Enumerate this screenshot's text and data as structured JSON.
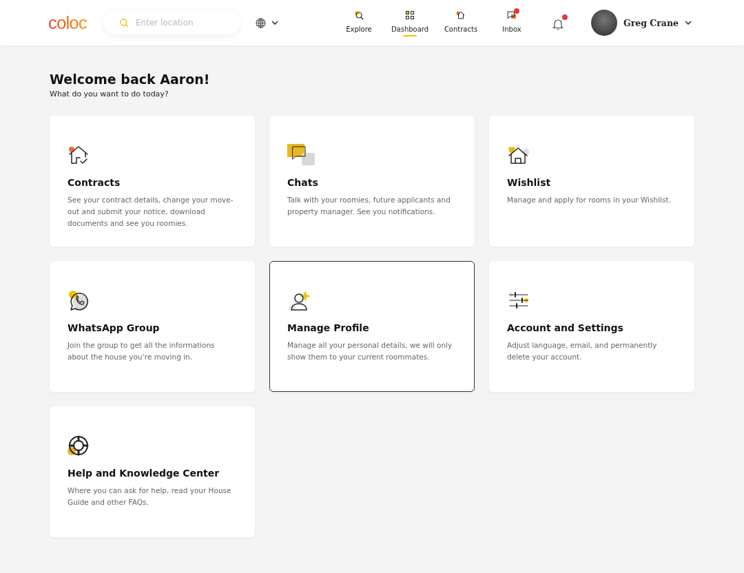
{
  "header": {
    "logo": "coloc",
    "search": {
      "placeholder": "Enter location"
    },
    "nav": [
      {
        "label": "Explore",
        "kind": "explore",
        "selected": false,
        "unread": false
      },
      {
        "label": "Dashboard",
        "kind": "dashboard",
        "selected": true,
        "unread": false
      },
      {
        "label": "Contracts",
        "kind": "contracts",
        "selected": false,
        "unread": false
      },
      {
        "label": "Inbox",
        "kind": "inbox",
        "selected": false,
        "unread": true
      }
    ],
    "notifications": {
      "unread": true
    },
    "user": {
      "name": "Greg Crane"
    }
  },
  "welcome": {
    "title": "Welcome back Aaron!",
    "subtitle": "What do you want to do today?"
  },
  "cards": [
    {
      "kind": "contracts",
      "title": "Contracts",
      "description": "See your contract details, change your move-out and submit your notice, download documents and see you roomies.",
      "selected": false
    },
    {
      "kind": "chats",
      "title": "Chats",
      "description": "Talk with your roomies, future applicants and property manager. See you notifications.",
      "selected": false
    },
    {
      "kind": "wishlist",
      "title": "Wishlist",
      "description": "Manage and apply for rooms in your Wishlist.",
      "selected": false
    },
    {
      "kind": "whatsapp",
      "title": "WhatsApp Group",
      "description": "Join the group to get all the informations about the house you’re moving in.",
      "selected": false
    },
    {
      "kind": "profile",
      "title": "Manage Profile",
      "description": "Manage all your personal details, we will only show them to your current roommates.",
      "selected": true
    },
    {
      "kind": "settings",
      "title": "Account and Settings",
      "description": "Adjust language, email, and permanently delete your account.",
      "selected": false
    },
    {
      "kind": "help",
      "title": "Help and Knowledge Center",
      "description": "Where you can ask for help, read your House Guide and other FAQs.",
      "selected": false
    }
  ]
}
